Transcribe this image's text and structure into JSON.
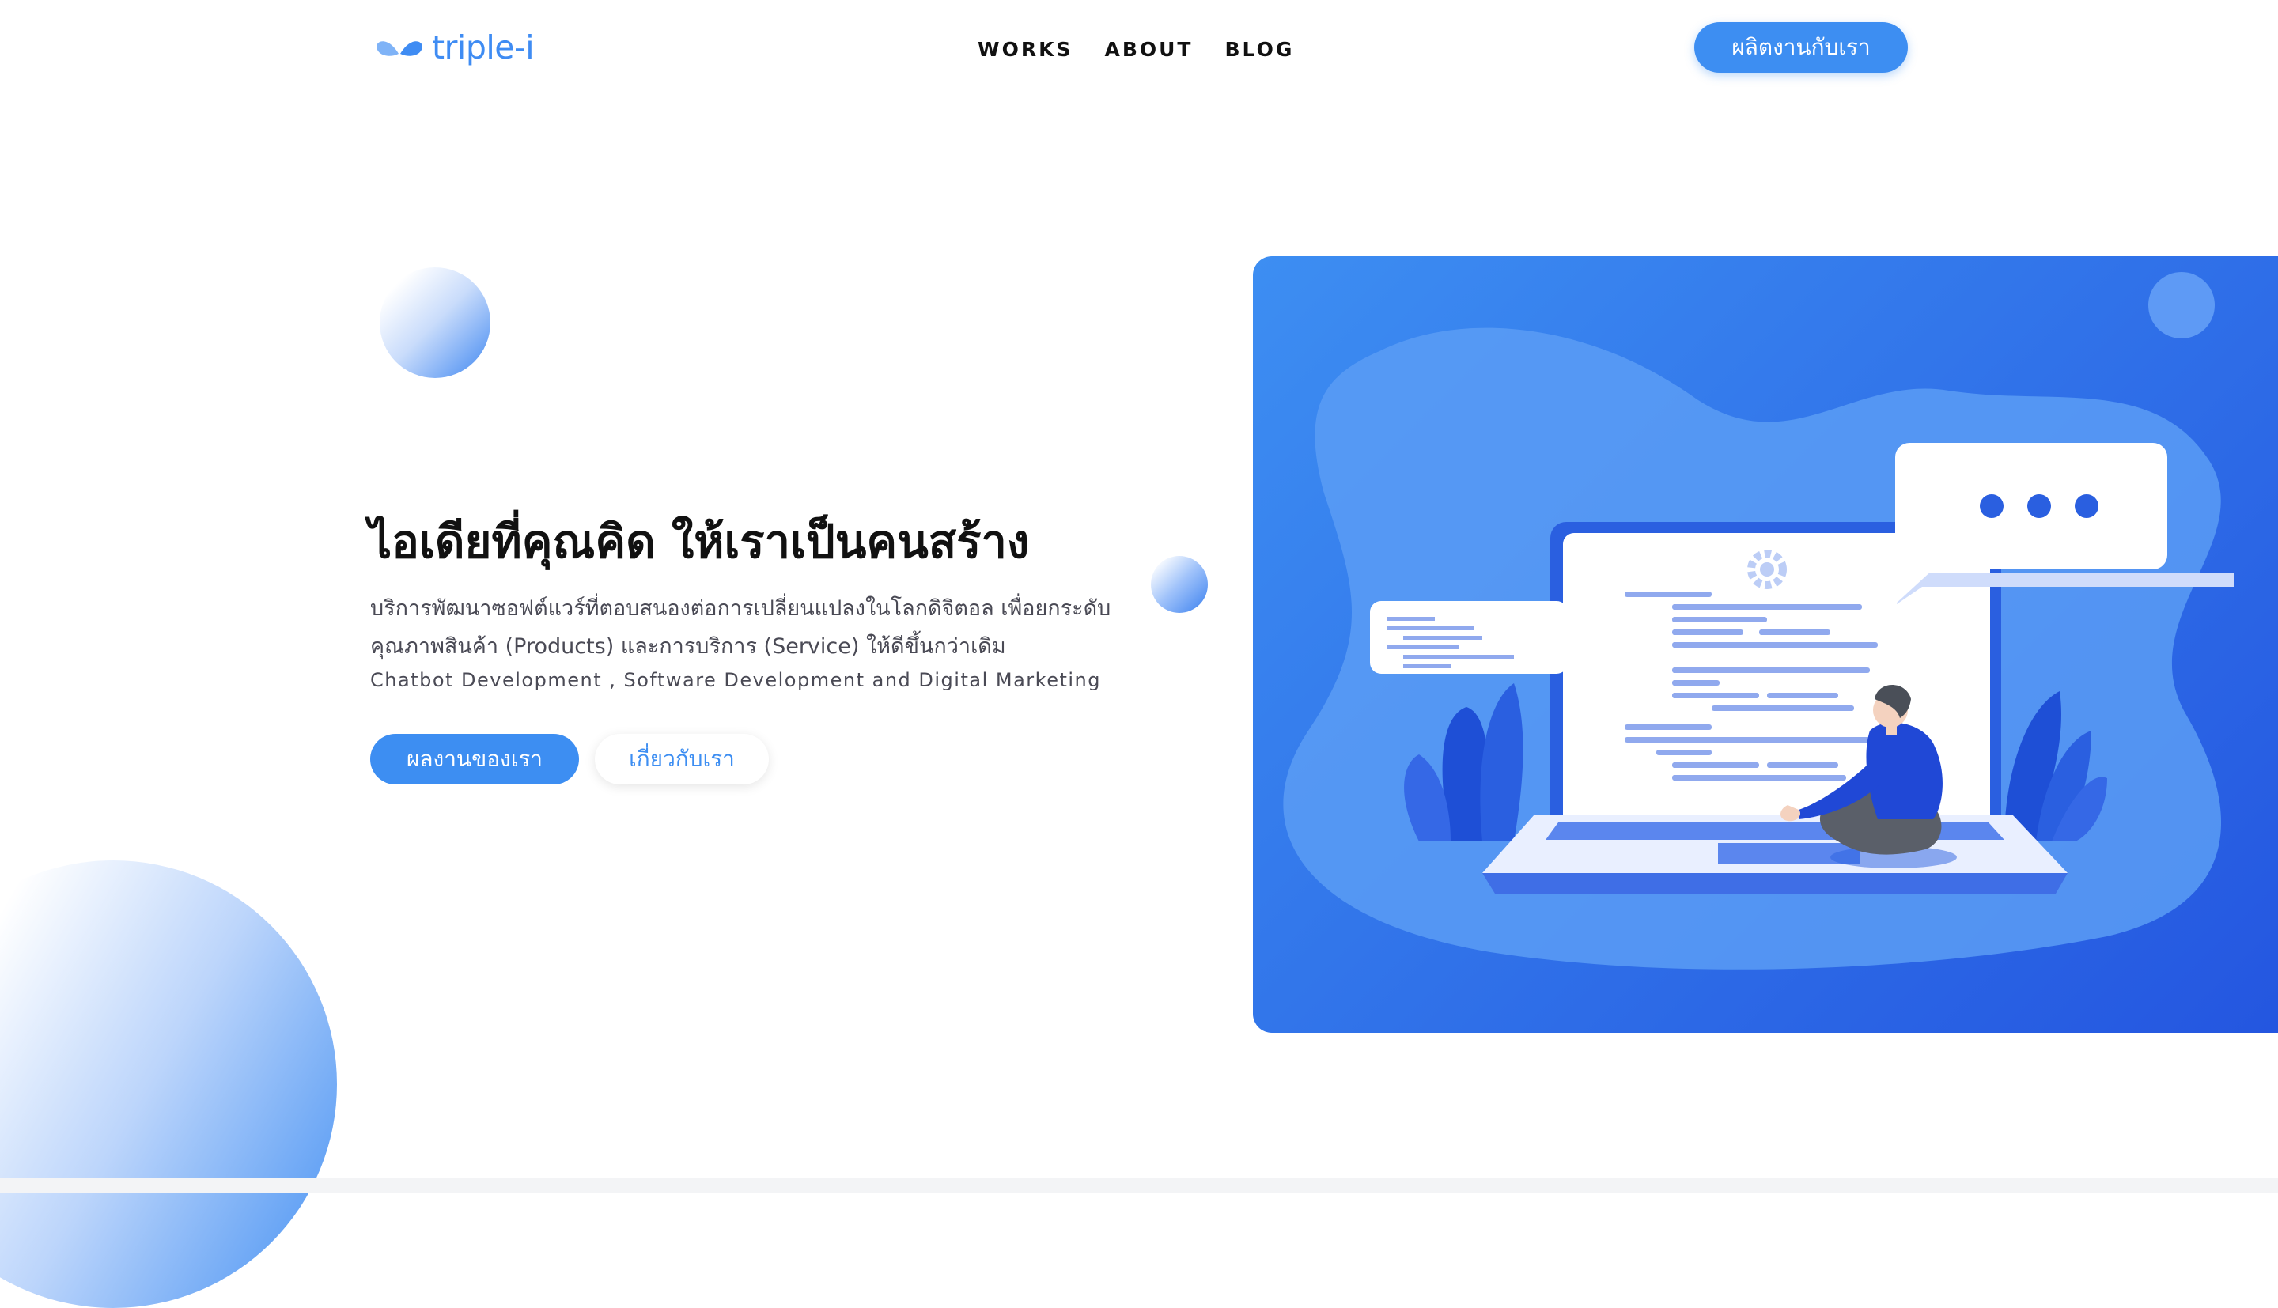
{
  "brand": {
    "name": "triple-i",
    "color": "#3f8cf3"
  },
  "nav": {
    "items": [
      "WORKS",
      "ABOUT",
      "BLOG"
    ]
  },
  "header": {
    "cta_label": "ผลิตงานกับเรา"
  },
  "hero": {
    "title": "ไอเดียที่คุณคิด ให้เราเป็นคนสร้าง",
    "description": "บริการพัฒนาซอฟต์แวร์ที่ตอบสนองต่อการเปลี่ยนแปลงในโลกดิจิตอล เพื่อยกระดับคุณภาพสินค้า (Products) และการบริการ (Service) ให้ดีขึ้นกว่าเดิม",
    "subline": "Chatbot Development , Software Development and Digital Marketing",
    "primary_button": "ผลงานของเรา",
    "secondary_button": "เกี่ยวกับเรา"
  },
  "colors": {
    "accent": "#3d8ef2",
    "panel_dark": "#2456e0",
    "panel_light": "#5b9cf5"
  },
  "illustration": {
    "icons": [
      "laptop-icon",
      "gear-icon",
      "chat-bubble-icon",
      "person-icon",
      "plant-icon"
    ]
  }
}
